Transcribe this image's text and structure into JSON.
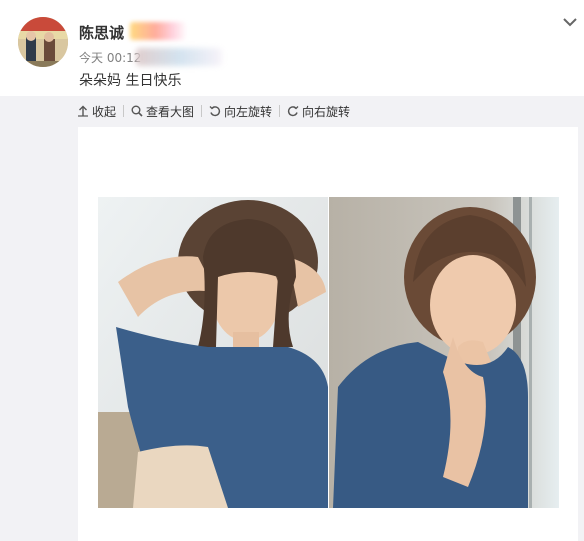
{
  "post": {
    "username": "陈思诚",
    "time": "今天 00:12",
    "text": "朵朵妈 生日快乐"
  },
  "toolbar": {
    "collapse_label": "收起",
    "view_large_label": "查看大图",
    "rotate_left_label": "向左旋转",
    "rotate_right_label": "向右旋转"
  },
  "icons": {
    "collapse": "arrow-up-icon",
    "view_large": "magnifier-icon",
    "rotate_left": "rotate-left-icon",
    "rotate_right": "rotate-right-icon",
    "more": "chevron-down-icon"
  },
  "colors": {
    "panel_bg": "#f2f2f5",
    "text": "#333333",
    "meta": "#808080",
    "shirt": "#3b5f8a"
  }
}
